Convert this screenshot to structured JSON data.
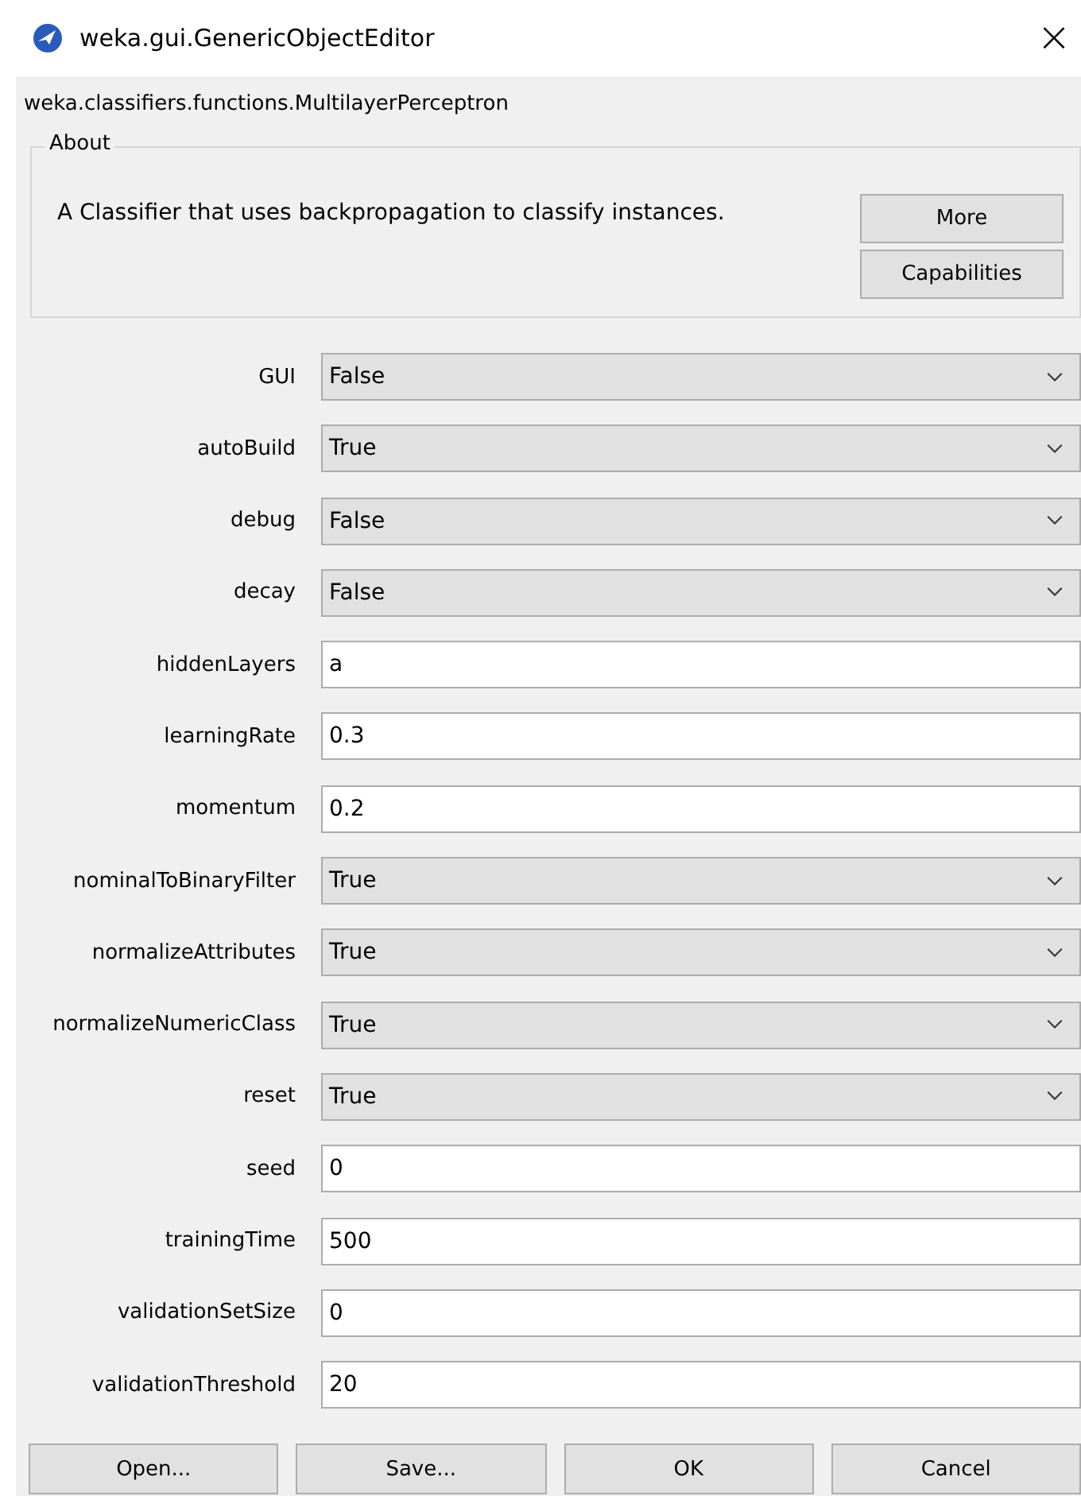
{
  "window": {
    "title": "weka.gui.GenericObjectEditor",
    "close": "×"
  },
  "class_name": "weka.classifiers.functions.MultilayerPerceptron",
  "about": {
    "title": "About",
    "text": "A Classifier that uses backpropagation to classify instances.",
    "buttons": [
      "More",
      "Capabilities"
    ]
  },
  "properties": [
    {
      "label": "GUI",
      "kind": "dropdown",
      "value": "False"
    },
    {
      "label": "autoBuild",
      "kind": "dropdown",
      "value": "True"
    },
    {
      "label": "debug",
      "kind": "dropdown",
      "value": "False"
    },
    {
      "label": "decay",
      "kind": "dropdown",
      "value": "False"
    },
    {
      "label": "hiddenLayers",
      "kind": "text",
      "value": "a"
    },
    {
      "label": "learningRate",
      "kind": "text",
      "value": "0.3"
    },
    {
      "label": "momentum",
      "kind": "text",
      "value": "0.2"
    },
    {
      "label": "nominalToBinaryFilter",
      "kind": "dropdown",
      "value": "True"
    },
    {
      "label": "normalizeAttributes",
      "kind": "dropdown",
      "value": "True"
    },
    {
      "label": "normalizeNumericClass",
      "kind": "dropdown",
      "value": "True"
    },
    {
      "label": "reset",
      "kind": "dropdown",
      "value": "True"
    },
    {
      "label": "seed",
      "kind": "text",
      "value": "0"
    },
    {
      "label": "trainingTime",
      "kind": "text",
      "value": "500"
    },
    {
      "label": "validationSetSize",
      "kind": "text",
      "value": "0"
    },
    {
      "label": "validationThreshold",
      "kind": "text",
      "value": "20"
    }
  ],
  "buttons": [
    "Open...",
    "Save...",
    "OK",
    "Cancel"
  ]
}
